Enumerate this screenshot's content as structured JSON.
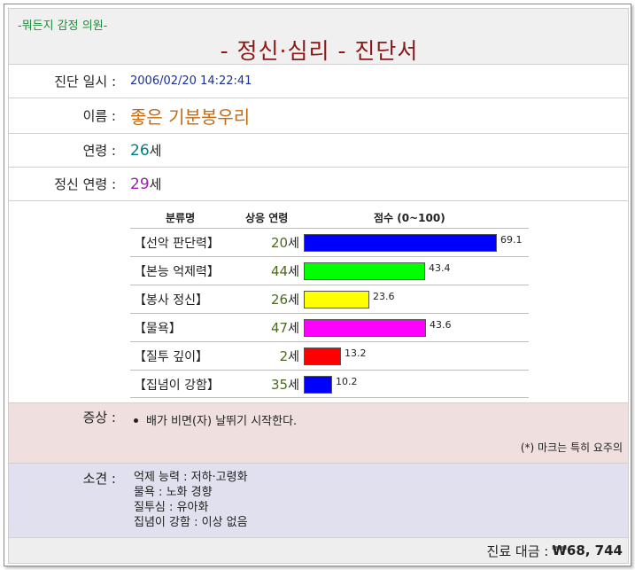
{
  "header": {
    "clinic_name": "-뭐든지 감정 의원-",
    "title": "- 정신·심리 -   진단서"
  },
  "diagnosis_date": {
    "label": "진단 일시 :",
    "value": "2006/02/20 14:22:41"
  },
  "name": {
    "label": "이름 :",
    "value": "좋은 기분봉우리"
  },
  "age": {
    "label": "연령 :",
    "number": "26",
    "suffix": "세"
  },
  "mental_age": {
    "label": "정신 연령 :",
    "number": "29",
    "suffix": "세"
  },
  "table": {
    "headers": {
      "category": "분류명",
      "corresponding_age": "상응 연령",
      "score": "점수 (0~100)"
    },
    "rows": [
      {
        "category": "【선악 판단력】",
        "age": "20",
        "age_suffix": "세",
        "score": 69.1,
        "score_label": "69.1",
        "color": "#0000ff"
      },
      {
        "category": "【본능 억제력】",
        "age": "44",
        "age_suffix": "세",
        "score": 43.4,
        "score_label": "43.4",
        "color": "#00ff00"
      },
      {
        "category": "【봉사 정신】",
        "age": "26",
        "age_suffix": "세",
        "score": 23.6,
        "score_label": "23.6",
        "color": "#ffff00"
      },
      {
        "category": "【물욕】",
        "age": "47",
        "age_suffix": "세",
        "score": 43.6,
        "score_label": "43.6",
        "color": "#ff00ff"
      },
      {
        "category": "【질투 깊이】",
        "age": "2",
        "age_suffix": "세",
        "score": 13.2,
        "score_label": "13.2",
        "color": "#ff0000"
      },
      {
        "category": "【집념이 강함】",
        "age": "35",
        "age_suffix": "세",
        "score": 10.2,
        "score_label": "10.2",
        "color": "#0000ff"
      }
    ]
  },
  "symptoms": {
    "label": "증상 :",
    "item": "배가 비면(자) 날뛰기 시작한다.",
    "note": "(*) 마크는 특히 요주의"
  },
  "opinion": {
    "label": "소견 :",
    "lines": [
      "억제 능력 : 저하·고령화",
      "물욕 : 노화 경향",
      "질투심 : 유아화",
      "집념이 강함 : 이상 없음"
    ]
  },
  "fee": {
    "label": "진료 대금 :",
    "amount": "₩68, 744"
  },
  "colors": {
    "age_number": "#008080",
    "mental_age_number": "#9b1fb0",
    "title": "#8a1818",
    "clinic": "#1d8c3a",
    "symptom_bg": "#efdfdf",
    "opinion_bg": "#e0e0ee"
  }
}
